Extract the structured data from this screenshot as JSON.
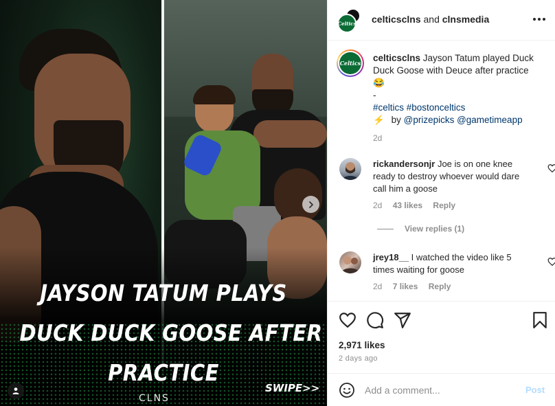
{
  "media": {
    "headline_lines": [
      "JAYSON TATUM PLAYS",
      "DUCK DUCK GOOSE AFTER",
      "PRACTICE"
    ],
    "swipe_label": "SWIPE>>",
    "brand_watermark": "CLNS",
    "next_icon": "chevron-right-icon",
    "tag_icon": "user-tag-icon"
  },
  "header": {
    "account_1": "celticsclns",
    "joiner": " and ",
    "account_2": "clnsmedia",
    "more_icon": "more-horizontal-icon"
  },
  "caption": {
    "username": "celticsclns",
    "text": " Jayson Tatum played Duck Duck Goose with Deuce after practice",
    "emoji": "😂",
    "separator": "-",
    "hashtags": "#celtics #bostonceltics",
    "lightning": "⚡",
    "by_text": "by",
    "mentions": "@prizepicks @gametimeapp",
    "time": "2d",
    "avatar_text": "Celtics"
  },
  "comments": [
    {
      "username": "rickandersonjr",
      "text": " Joe is on one knee ready to destroy whoever would dare call him a goose",
      "time": "2d",
      "likes": "43 likes",
      "reply": "Reply"
    },
    {
      "username": "jrey18__",
      "text": " I watched the video like 5 times waiting for goose",
      "time": "2d",
      "likes": "7 likes",
      "reply": "Reply"
    }
  ],
  "view_replies": "View replies (1)",
  "actions": {
    "likes": "2,971 likes",
    "ago": "2 days ago"
  },
  "comment_box": {
    "placeholder": "Add a comment...",
    "post_label": "Post"
  },
  "colors": {
    "link": "#00376b",
    "muted": "#8e8e8e",
    "post_disabled": "#b3dbff",
    "celtics_green": "#0b6b35"
  }
}
